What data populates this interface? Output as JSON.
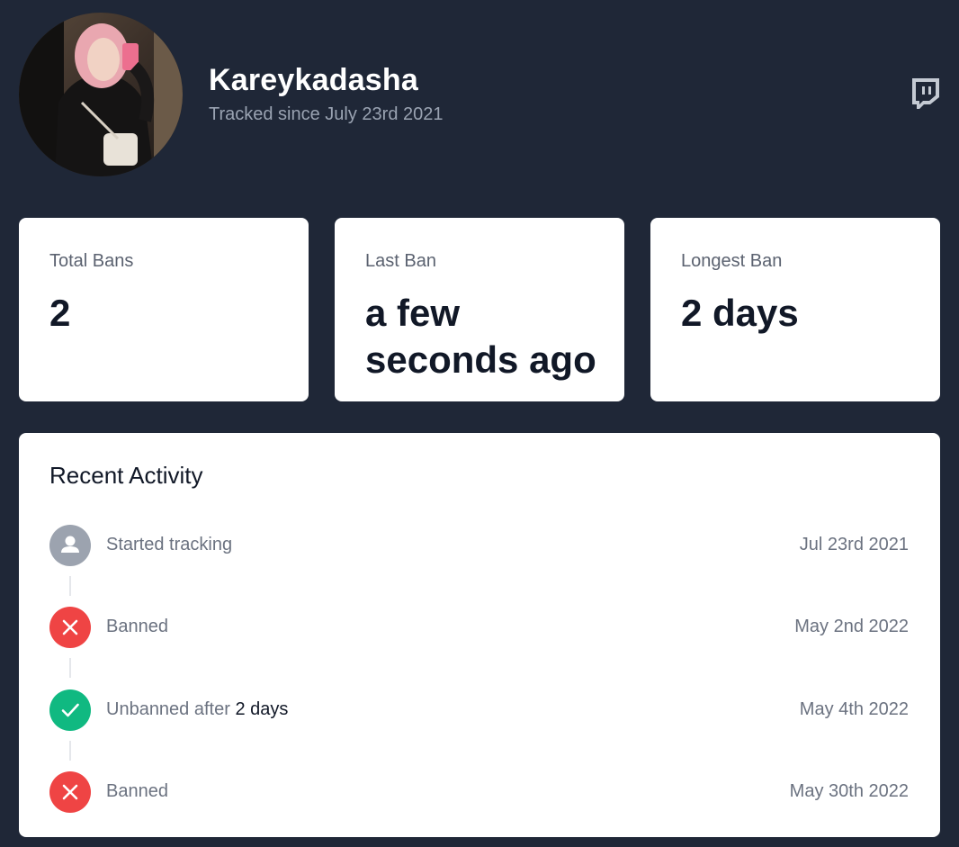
{
  "profile": {
    "name": "Kareykadasha",
    "tracked_since": "Tracked since July 23rd 2021",
    "platform_icon": "twitch-icon"
  },
  "stats": [
    {
      "label": "Total Bans",
      "value": "2"
    },
    {
      "label": "Last Ban",
      "value": "a few seconds ago"
    },
    {
      "label": "Longest Ban",
      "value": "2 days"
    }
  ],
  "activity": {
    "title": "Recent Activity",
    "items": [
      {
        "icon": "user-icon",
        "text": "Started tracking",
        "date": "Jul 23rd 2021"
      },
      {
        "icon": "x-icon",
        "text": "Banned",
        "date": "May 2nd 2022"
      },
      {
        "icon": "check-icon",
        "text": "Unbanned after",
        "text_strong": "2 days",
        "date": "May 4th 2022"
      },
      {
        "icon": "x-icon",
        "text": "Banned",
        "date": "May 30th 2022"
      }
    ]
  },
  "colors": {
    "background": "#1f2737",
    "card": "#ffffff",
    "banned": "#ef4444",
    "unbanned": "#10b981",
    "neutral": "#9ca3af"
  }
}
